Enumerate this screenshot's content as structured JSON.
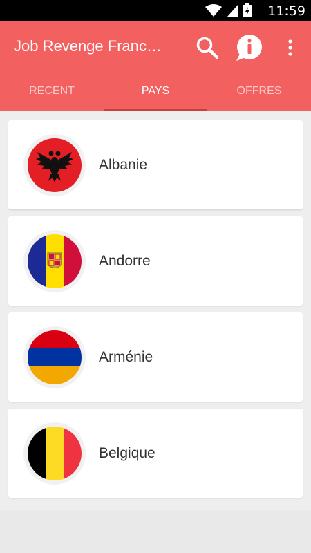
{
  "status_bar": {
    "time": "11:59",
    "icons": [
      "wifi-icon",
      "signal-icon",
      "battery-charging-icon"
    ]
  },
  "app_bar": {
    "title": "Job Revenge Franc…",
    "actions": [
      "search-icon",
      "info-icon",
      "more-vert-icon"
    ],
    "color": "#f2605f"
  },
  "tabs": [
    {
      "label": "RECENT",
      "active": false
    },
    {
      "label": "PAYS",
      "active": true
    },
    {
      "label": "OFFRES",
      "active": false
    }
  ],
  "countries": [
    {
      "name": "Albanie",
      "flag_icon": "albania-flag-icon"
    },
    {
      "name": "Andorre",
      "flag_icon": "andorra-flag-icon"
    },
    {
      "name": "Arménie",
      "flag_icon": "armenia-flag-icon"
    },
    {
      "name": "Belgique",
      "flag_icon": "belgium-flag-icon"
    }
  ]
}
